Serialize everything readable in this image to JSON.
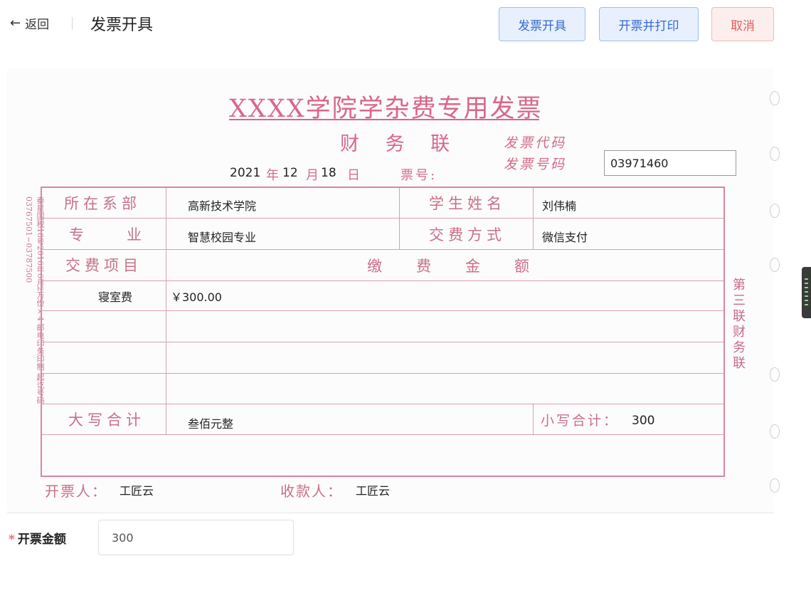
{
  "header": {
    "back_label": "返回",
    "title": "发票开具",
    "buttons": {
      "issue": "发票开具",
      "issue_print": "开票并打印",
      "cancel": "取消"
    }
  },
  "invoice": {
    "title": "XXXX学院学杂费专用发票",
    "subtitle": "财 务 联",
    "code_label": "发票代码",
    "number_label": "发票号码",
    "number_value": "03971460",
    "date": {
      "year": "2021",
      "year_unit": "年",
      "month": "12",
      "month_unit": "月",
      "day": "18",
      "day_unit": "日"
    },
    "ticket_label": "票号:",
    "side_left": "秦星国税18号2016年6月2万份×4 邮电印务印制 起讫号码03767501~03787500",
    "side_right": "第三联 财务联",
    "rows": {
      "dept_label": "所在系部",
      "dept_value": "高新技术学院",
      "student_label": "学生姓名",
      "student_value": "刘伟楠",
      "major_label": "专　　业",
      "major_value": "智慧校园专业",
      "pay_method_label": "交费方式",
      "pay_method_value": "微信支付",
      "item_label": "交费项目",
      "amount_header": "缴　　费　　金　　额",
      "item_name": "寝室费",
      "item_amount": "￥300.00",
      "total_upper_label": "大写合计",
      "total_upper_value": "叁佰元整",
      "total_lower_label": "小写合计：",
      "total_lower_value": "300"
    },
    "issuer_label": "开票人：",
    "issuer_value": "工匠云",
    "payee_label": "收款人：",
    "payee_value": "工匠云"
  },
  "form": {
    "amount_label": "开票金额",
    "required_mark": "*",
    "amount_value": "300"
  },
  "colors": {
    "invoice_pink": "#d46b88",
    "primary_blue": "#3569d3",
    "danger_red": "#e25c5c"
  }
}
